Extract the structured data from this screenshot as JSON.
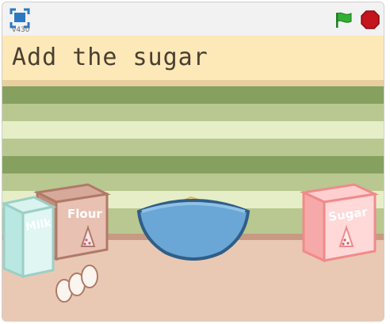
{
  "player": {
    "version": "v430",
    "icons": {
      "fullscreen": "fullscreen-icon",
      "green_flag": "green-flag-icon",
      "stop": "stop-icon"
    },
    "colors": {
      "flag": "#31b035",
      "stop": "#c4141d",
      "fullscreen": "#2b79c2"
    }
  },
  "stage": {
    "caption": "Add the sugar",
    "items": {
      "milk_label": "Milk",
      "flour_label": "Flour",
      "sugar_label": "Sugar"
    },
    "colors": {
      "caption_bg": "#fde8b8",
      "stripe_dark": "#86a060",
      "stripe_light": "#e6eec8",
      "floor": "#e9c9b4",
      "bowl": "#6aa6d6"
    }
  }
}
